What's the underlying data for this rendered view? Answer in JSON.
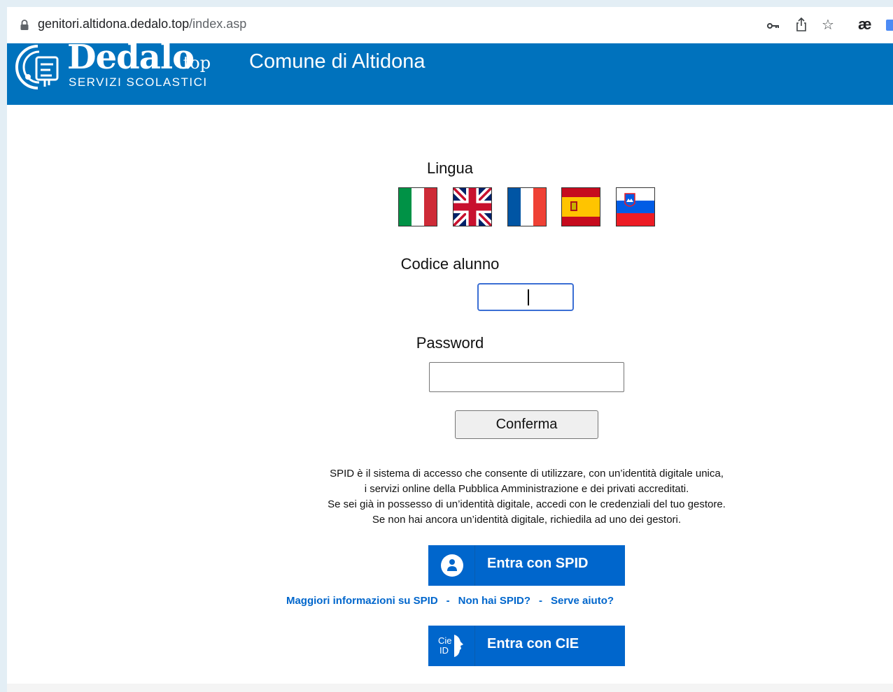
{
  "browser": {
    "url_host": "genitori.altidona.dedalo.top",
    "url_path": "/index.asp",
    "extension_label": "æ"
  },
  "header": {
    "brand": "Dedalo",
    "brand_suffix": ".top",
    "brand_sub": "SERVIZI SCOLASTICI",
    "title": "Comune di Altidona",
    "color": "#0072bd"
  },
  "login": {
    "language_label": "Lingua",
    "languages": [
      "it",
      "en",
      "fr",
      "es",
      "sl"
    ],
    "code_label": "Codice alunno",
    "code_value": "",
    "password_label": "Password",
    "password_value": "",
    "confirm_label": "Conferma"
  },
  "spid": {
    "info_lines": [
      "SPID è il sistema di accesso che consente di utilizzare, con un’identità digitale unica,",
      "i servizi online della Pubblica Amministrazione e dei privati accreditati.",
      "Se sei già in possesso di un’identità digitale, accedi con le credenziali del tuo gestore.",
      "Se non hai ancora un’identità digitale, richiedila ad uno dei gestori."
    ],
    "spid_button": "Entra con SPID",
    "links": [
      "Maggiori informazioni su SPID",
      "Non hai SPID?",
      "Serve aiuto?"
    ],
    "link_separator": "-",
    "cie_button": "Entra con CIE",
    "cie_icon_text": [
      "Cie",
      "ID"
    ],
    "button_color": "#0066cc"
  }
}
